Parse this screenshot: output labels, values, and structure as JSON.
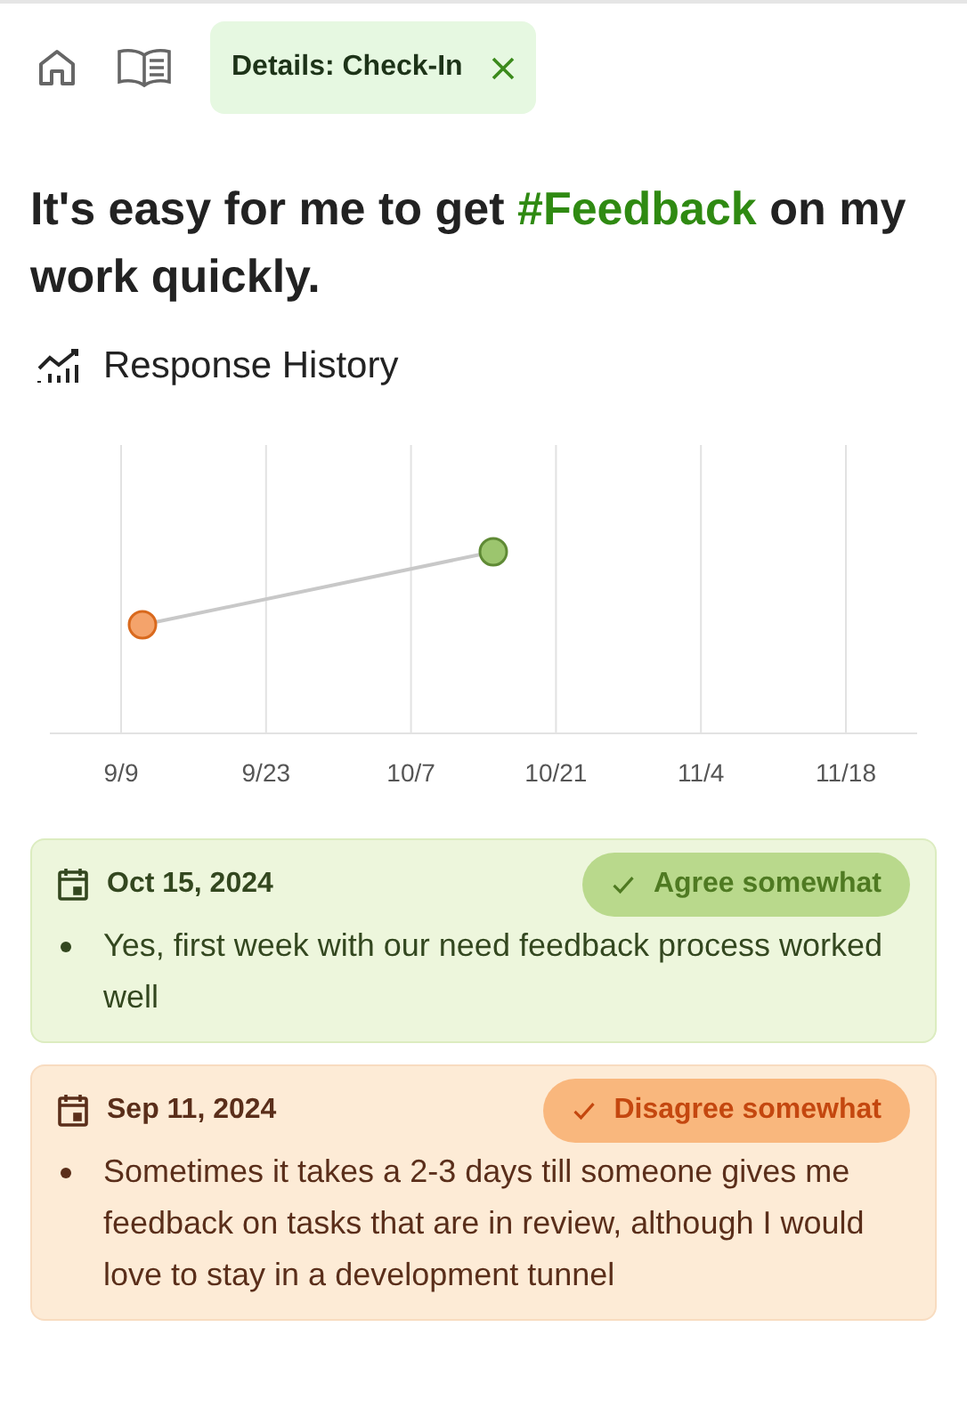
{
  "nav": {
    "tab_label": "Details: Check-In",
    "tab_selected": true
  },
  "question": "It's easy for me to get **#Feedback** on my work quickly.",
  "history": {
    "title": "Response History",
    "xticks": [
      "9/9",
      "9/23",
      "10/7",
      "10/21",
      "11/4",
      "11/18"
    ],
    "points": [
      {
        "color": "#f4a36b"
      },
      {
        "color": "#9cc56e"
      }
    ]
  },
  "responses": [
    {
      "date": "Oct 15, 2024",
      "kind": "agree",
      "answer": "Agree somewhat",
      "comment": "Yes, first week with our need feedback process worked well"
    },
    {
      "date": "Sep 11, 2024",
      "kind": "disagree",
      "answer": "Disagree somewhat",
      "comment": "Sometimes it takes a 2-3 days till someone gives me feedback on tasks that are in review, although I would love to stay in a development tunnel"
    }
  ]
}
